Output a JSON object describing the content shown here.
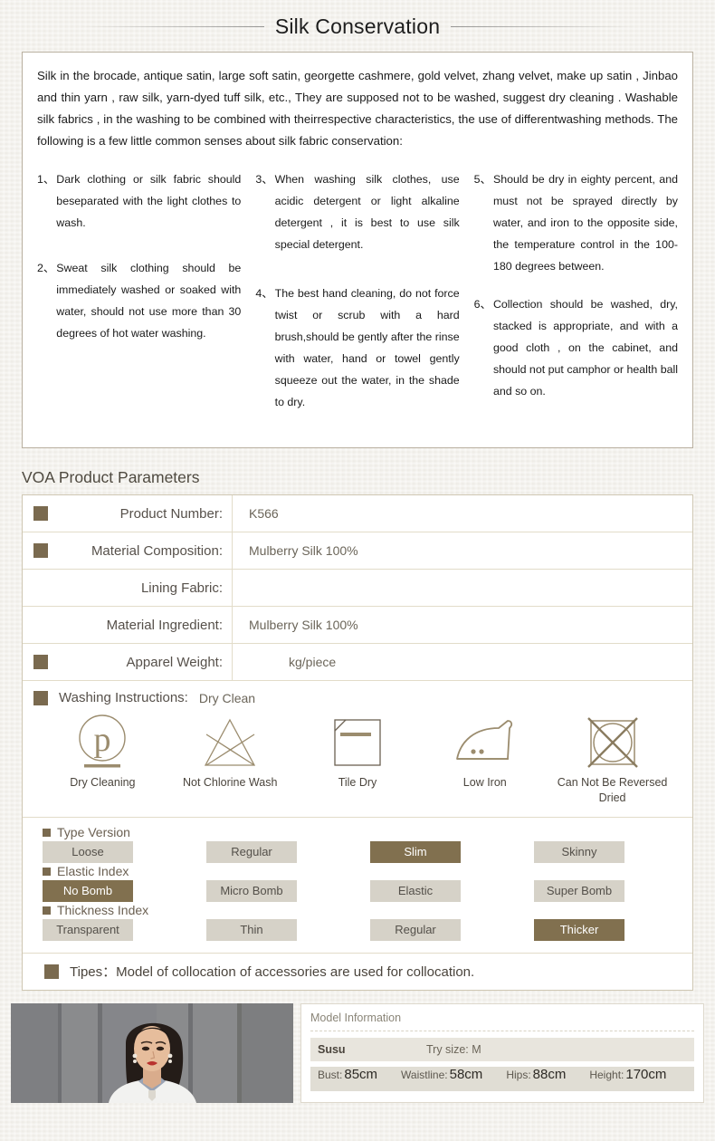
{
  "header": {
    "title": "Silk Conservation"
  },
  "conservation": {
    "intro": "Silk in the brocade, antique satin, large soft satin, georgette cashmere, gold velvet, zhang velvet, make up satin , Jinbao and thin yarn , raw silk, yarn-dyed tuff silk, etc., They are supposed not to be washed, suggest dry cleaning . Washable silk fabrics , in the washing to be combined with theirrespective characteristics, the use of differentwashing methods. The following is a few little common senses about silk fabric conservation:",
    "tips": [
      {
        "num": "1、",
        "text": "Dark clothing or silk fabric should beseparated with the light clothes to wash."
      },
      {
        "num": "2、",
        "text": "Sweat silk clothing should be immediately washed or soaked with water, should not use more than 30 degrees of hot water washing."
      },
      {
        "num": "3、",
        "text": "When washing silk clothes, use acidic detergent or light alkaline detergent , it is best to use silk special detergent."
      },
      {
        "num": "4、",
        "text": "The best hand cleaning, do not force twist or scrub with a hard brush,should be gently after the rinse with water, hand or towel gently squeeze out the water, in the shade to dry."
      },
      {
        "num": "5、",
        "text": "Should be dry in eighty percent, and must not be sprayed directly by water, and iron to the opposite side, the temperature control in the 100-180 degrees between."
      },
      {
        "num": "6、",
        "text": "Collection should be washed, dry, stacked is appropriate, and with a good cloth , on the cabinet, and should not put camphor or health ball and so on."
      }
    ]
  },
  "parameters": {
    "section_title": "VOA Product Parameters",
    "rows": [
      {
        "label": "Product Number:",
        "value": "K566",
        "bullet": true
      },
      {
        "label": "Material Composition:",
        "value": "Mulberry Silk 100%",
        "bullet": true
      },
      {
        "label": "Lining Fabric:",
        "value": "",
        "bullet": false
      },
      {
        "label": "Material Ingredient:",
        "value": "Mulberry Silk 100%",
        "bullet": false
      },
      {
        "label": "Apparel Weight:",
        "value": "kg/piece",
        "bullet": true
      }
    ]
  },
  "washing": {
    "title": "Washing Instructions:",
    "value": "Dry Clean",
    "icons": [
      {
        "icon": "dry-cleaning-icon",
        "caption": "Dry Cleaning"
      },
      {
        "icon": "not-chlorine-wash-icon",
        "caption": "Not Chlorine Wash"
      },
      {
        "icon": "tile-dry-icon",
        "caption": "Tile Dry"
      },
      {
        "icon": "low-iron-icon",
        "caption": "Low Iron"
      },
      {
        "icon": "no-tumble-dry-icon",
        "caption": "Can Not Be Reversed Dried"
      }
    ]
  },
  "indexes": [
    {
      "title": "Type Version",
      "tags": [
        {
          "label": "Loose",
          "selected": false
        },
        {
          "label": "Regular",
          "selected": false
        },
        {
          "label": "Slim",
          "selected": true
        },
        {
          "label": "Skinny",
          "selected": false
        }
      ]
    },
    {
      "title": "Elastic Index",
      "tags": [
        {
          "label": "No  Bomb",
          "selected": true
        },
        {
          "label": "Micro  Bomb",
          "selected": false
        },
        {
          "label": "Elastic",
          "selected": false
        },
        {
          "label": "Super  Bomb",
          "selected": false
        }
      ]
    },
    {
      "title": "Thickness Index",
      "tags": [
        {
          "label": "Transparent",
          "selected": false
        },
        {
          "label": "Thin",
          "selected": false
        },
        {
          "label": "Regular",
          "selected": false
        },
        {
          "label": "Thicker",
          "selected": true
        }
      ]
    }
  ],
  "tipes": {
    "text": "Tipes：Model of collocation of accessories are used for collocation."
  },
  "model": {
    "panel_title": "Model Information",
    "name": "Susu",
    "try_size": "Try size: M",
    "measurements": [
      {
        "key": "Bust:",
        "value": "85cm"
      },
      {
        "key": "Waistline:",
        "value": "58cm"
      },
      {
        "key": "Hips:",
        "value": "88cm"
      },
      {
        "key": "Height:",
        "value": "170cm"
      }
    ]
  },
  "colors": {
    "brown": "#7a6a4f",
    "tag_selected": "#81704f",
    "tag_unselected": "#d6d2c8",
    "page_bg": "#f2f0eb"
  }
}
